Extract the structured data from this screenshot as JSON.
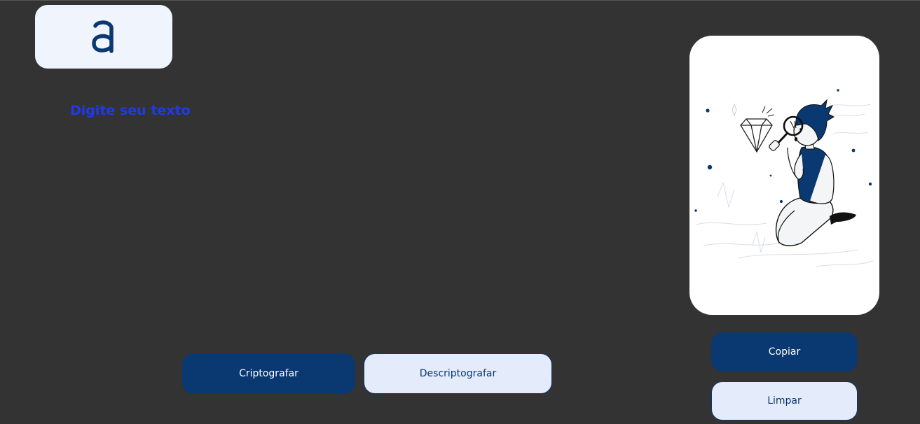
{
  "logo": {
    "glyph": "a",
    "icon": "logo-a-icon"
  },
  "input": {
    "placeholder": "Digite seu texto",
    "value": ""
  },
  "buttons": {
    "encrypt_label": "Criptografar",
    "decrypt_label": "Descriptografar",
    "copy_label": "Copiar",
    "clear_label": "Limpar"
  },
  "output": {
    "illustration": "person-with-magnifier-and-diamond-illustration"
  },
  "colors": {
    "background": "#333333",
    "primary": "#0a3871",
    "accent_text": "#1f3ae8",
    "light": "#e4ecfb",
    "card": "#ffffff"
  }
}
